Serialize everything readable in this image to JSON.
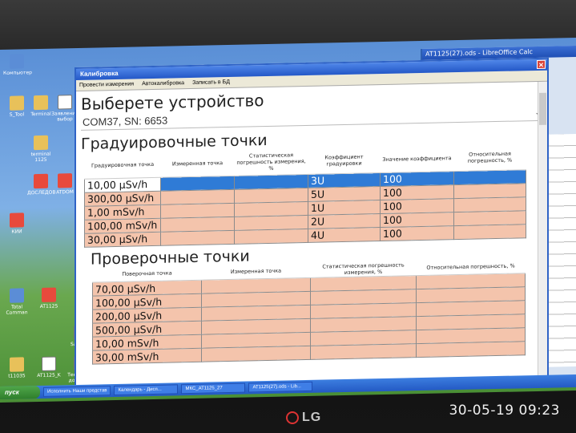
{
  "dialog": {
    "title": "Калибровка",
    "close": "✕",
    "menu": [
      "Провести измерения",
      "Автокалибровка",
      "Записать в БД"
    ],
    "heading_device": "Выберете устройство",
    "device_value": "COM37, SN: 6653"
  },
  "grad": {
    "heading": "Градуировочные точки",
    "columns": [
      "Градуировочная точка",
      "Измеренная точка",
      "Статистическая погрешность измерения, %",
      "Коэффициент градуировки",
      "Значение коэффициента",
      "Относительная погрешность, %"
    ],
    "rows": [
      [
        "10,00 µSv/h",
        "",
        "",
        "3U",
        "100",
        ""
      ],
      [
        "300,00 µSv/h",
        "",
        "",
        "5U",
        "100",
        ""
      ],
      [
        "1,00 mSv/h",
        "",
        "",
        "1U",
        "100",
        ""
      ],
      [
        "100,00 mSv/h",
        "",
        "",
        "2U",
        "100",
        ""
      ],
      [
        "30,00 µSv/h",
        "",
        "",
        "4U",
        "100",
        ""
      ]
    ]
  },
  "check": {
    "heading": "Проверочные точки",
    "columns": [
      "Поверочная точка",
      "Измеренная точка",
      "Статистическая погрешность измерения, %",
      "Относительная погрешность, %"
    ],
    "rows": [
      [
        "70,00 µSv/h",
        "",
        "",
        ""
      ],
      [
        "100,00 µSv/h",
        "",
        "",
        ""
      ],
      [
        "200,00 µSv/h",
        "",
        "",
        ""
      ],
      [
        "500,00 µSv/h",
        "",
        "",
        ""
      ],
      [
        "10,00 mSv/h",
        "",
        "",
        ""
      ],
      [
        "30,00 mSv/h",
        "",
        "",
        ""
      ]
    ]
  },
  "calc_title": "AT1125(27).ods - LibreOffice Calc",
  "taskbar": {
    "start": "пуск",
    "tasks": [
      "Исполнить Наши представ",
      "Календарь - Дисп...",
      "МКС_AT1125_27",
      "AT1125(27).ods - Lib..."
    ]
  },
  "desktop_icons": [
    "Компьютер",
    "S_Tool",
    "Terminal",
    "Заявления выбор",
    "terminal 1125",
    "ДОСЛЕДОВ",
    "ATDOM",
    "КИИ",
    "Total Comman",
    "AT1125",
    "Sarklech",
    "t11035",
    "AT1125_K",
    "Текстовый документ"
  ],
  "monitor_brand": "LG",
  "photo_timestamp": "30-05-19 09:23"
}
